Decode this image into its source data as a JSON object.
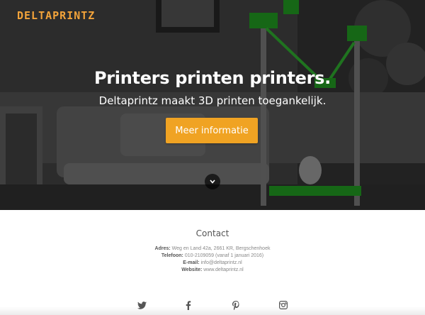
{
  "brand": {
    "logo_text": "DELTAPRINTZ",
    "accent_color": "#f0a323"
  },
  "hero": {
    "headline": "Printers printen printers.",
    "subline": "Deltaprintz maakt 3D printen toegankelijk.",
    "cta_label": "Meer informatie",
    "scroll_icon": "chevron-down-icon"
  },
  "contact": {
    "title": "Contact",
    "address_label": "Adres:",
    "address_value": "Weg en Land 42a, 2661 KR, Bergschenhoek",
    "phone_label": "Telefoon:",
    "phone_value": "010-2109059 (vanaf 1 januari 2016)",
    "email_label": "E-mail:",
    "email_value": "info@deltaprintz.nl",
    "website_label": "Website:",
    "website_value": "www.deltaprintz.nl"
  },
  "social": {
    "icons": [
      "twitter-icon",
      "facebook-icon",
      "pinterest-icon",
      "instagram-icon"
    ],
    "icon_color": "#555555"
  }
}
